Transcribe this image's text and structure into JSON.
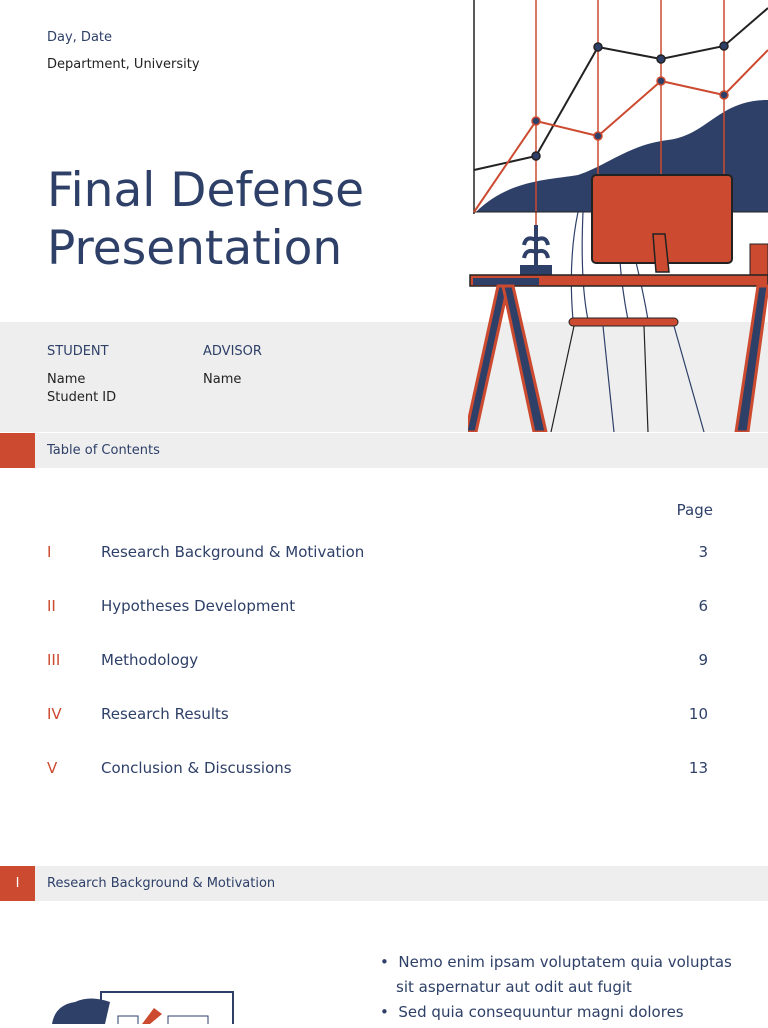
{
  "header": {
    "date": "Day, Date",
    "department": "Department, University",
    "title_line1": "Final Defense",
    "title_line2": "Presentation"
  },
  "info": {
    "student_label": "STUDENT",
    "student_name": "Name",
    "student_id": "Student ID",
    "advisor_label": "ADVISOR",
    "advisor_name": "Name"
  },
  "toc": {
    "section_title": "Table of Contents",
    "page_header": "Page",
    "items": [
      {
        "num": "I",
        "name": "Research Background & Motivation",
        "page": "3"
      },
      {
        "num": "II",
        "name": "Hypotheses Development",
        "page": "6"
      },
      {
        "num": "III",
        "name": "Methodology",
        "page": "9"
      },
      {
        "num": "IV",
        "name": "Research Results",
        "page": "10"
      },
      {
        "num": "V",
        "name": "Conclusion & Discussions",
        "page": "13"
      }
    ]
  },
  "section1": {
    "num": "I",
    "title": "Research Background & Motivation",
    "bullets": [
      "Nemo enim ipsam voluptatem quia voluptas sit aspernatur aut odit aut fugit",
      "Sed quia consequuntur magni dolores"
    ]
  },
  "colors": {
    "navy": "#2e4068",
    "accent": "#cc4b30",
    "band": "#eeeeee"
  }
}
